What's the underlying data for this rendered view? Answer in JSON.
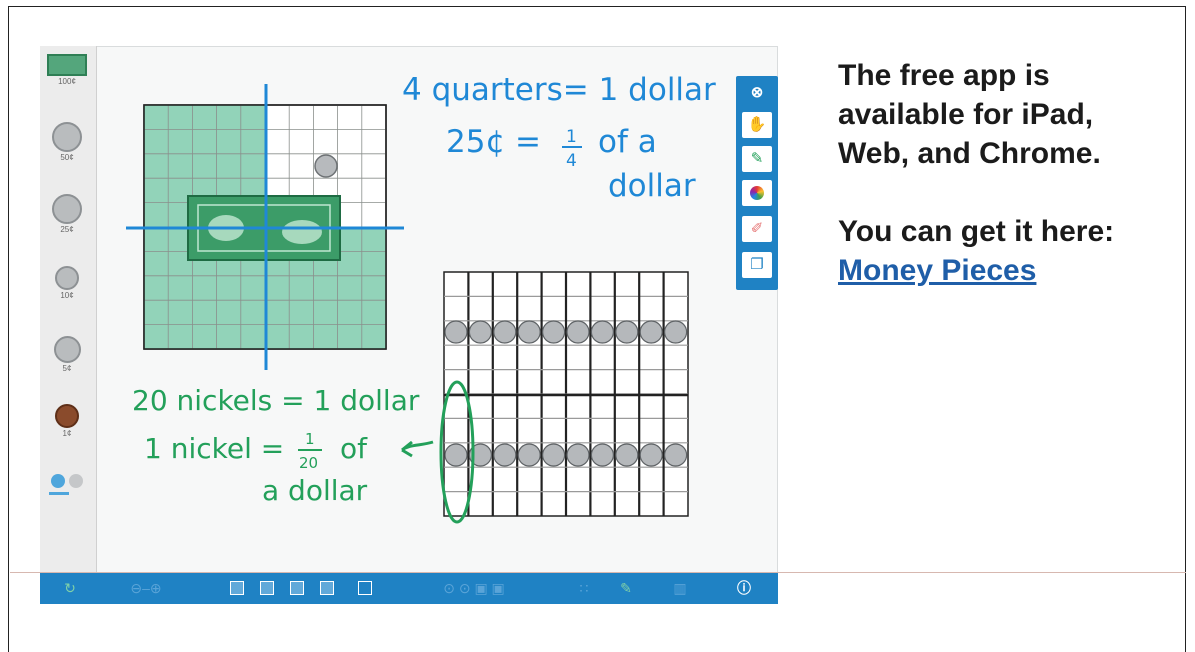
{
  "app": {
    "name": "Money Pieces",
    "tray": [
      {
        "label": "100¢",
        "kind": "bill"
      },
      {
        "label": "50¢",
        "kind": "coin"
      },
      {
        "label": "25¢",
        "kind": "coin"
      },
      {
        "label": "10¢",
        "kind": "coin"
      },
      {
        "label": "5¢",
        "kind": "coin"
      },
      {
        "label": "1¢",
        "kind": "penny"
      }
    ],
    "annotations": {
      "quarters_line1": "4 quarters= 1 dollar",
      "quarters_line2": "25¢ =",
      "quarters_frac_num": "1",
      "quarters_frac_den": "4",
      "quarters_line2b": "of a",
      "quarters_line3": "dollar",
      "nickels_line1": "20 nickels = 1 dollar",
      "nickels_line2": "1 nickel =",
      "nickels_frac_num": "1",
      "nickels_frac_den": "20",
      "nickels_line2b": "of",
      "nickels_line3": "a dollar"
    },
    "right_tools": [
      "close-icon",
      "hand-icon",
      "pen-icon",
      "color-wheel-icon",
      "eraser-icon",
      "page-icon"
    ],
    "bottom_bar": [
      "refresh-icon",
      "zoom-icon",
      "layout-1",
      "layout-2",
      "layout-3",
      "layout-4",
      "calendar-icon",
      "grid-icon",
      "pen-icon",
      "trash-icon",
      "info-icon"
    ],
    "colors": {
      "accent": "#1f82c4",
      "ink_blue": "#1f88d6",
      "ink_green": "#23a05a",
      "grid_green": "#6ec4a2"
    }
  },
  "panel": {
    "line1": "The free app is",
    "line2": "available for iPad,",
    "line3": "Web, and Chrome.",
    "line4": "You can get it here:",
    "link_text": "Money Pieces"
  }
}
